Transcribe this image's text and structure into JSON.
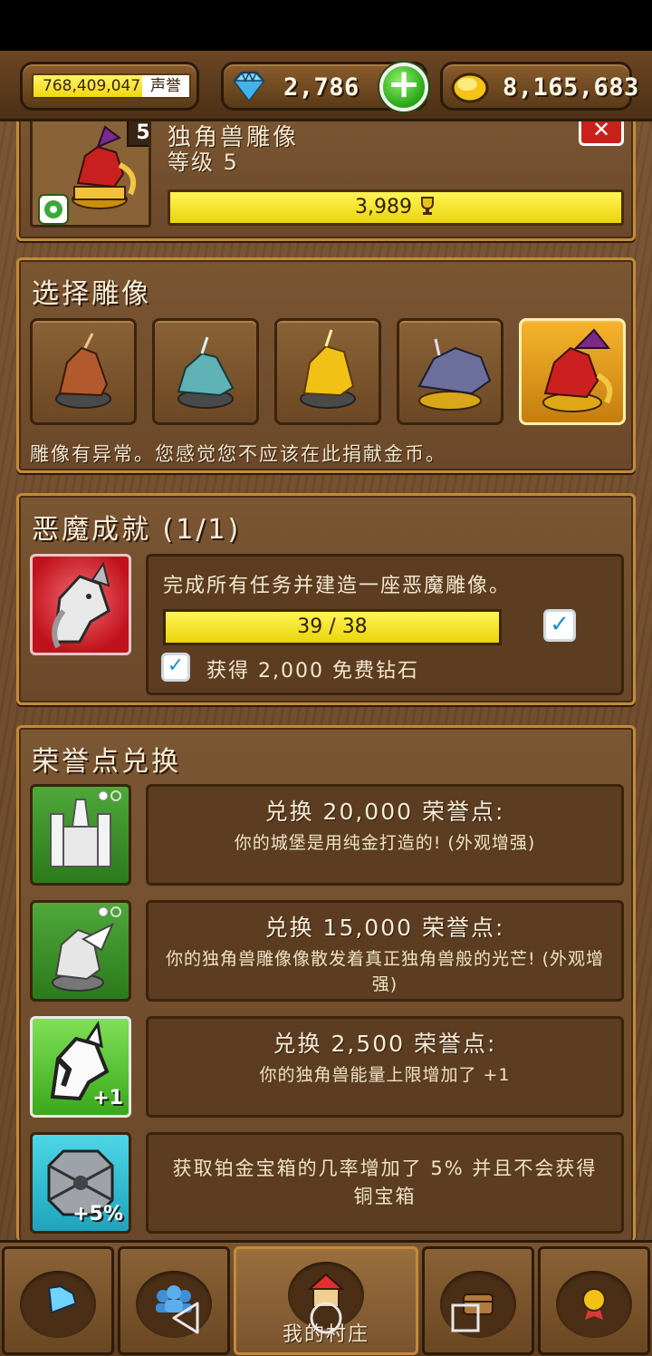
{
  "topbar": {
    "prestige_value": "768,409,047",
    "prestige_suffix": "声誉",
    "gems": "2,786",
    "add_label": "+",
    "gold": "8,165,683"
  },
  "statue_header": {
    "name": "独角兽雕像",
    "level": "等级 5",
    "level_badge": "5",
    "trophies": "3,989",
    "close_label": "✕"
  },
  "select_statue": {
    "title": "选择雕像",
    "statues": [
      "bronze-unicorn-statue",
      "teal-unicorn-statue",
      "gold-unicorn-statue",
      "dark-unicorn-statue",
      "demon-unicorn-statue"
    ],
    "selected_index": 4,
    "description": "雕像有异常。您感觉您不应该在此捐献金币。"
  },
  "demon_achievement": {
    "title": "恶魔成就 (1/1)",
    "description": "完成所有任务并建造一座恶魔雕像。",
    "progress_text": "39 / 38",
    "progress_fraction": 1.0,
    "reward": "获得 2,000 免费钻石"
  },
  "honor_exchange": {
    "title": "荣誉点兑换",
    "rows": [
      {
        "head": "兑换 20,000 荣誉点:",
        "desc": "你的城堡是用纯金打造的! (外观增强)"
      },
      {
        "head": "兑换 15,000 荣誉点:",
        "desc": "你的独角兽雕像像散发着真正独角兽般的光芒! (外观增强)"
      },
      {
        "head": "兑换 2,500 荣誉点:",
        "desc": "你的独角兽能量上限增加了 +1",
        "badge": "+1"
      },
      {
        "desc": "获取铂金宝箱的几率增加了 5% 并且不会获得铜宝箱",
        "badge": "+5%"
      }
    ]
  },
  "bottom_nav": {
    "tabs": [
      "gems",
      "friends",
      "my_village",
      "chest",
      "achievements"
    ],
    "active_label": "我的村庄"
  },
  "colors": {
    "wood": "#6e4b2b",
    "gold_border": "#c48a38",
    "progress_yellow": "#f5e21e",
    "check_blue": "#1f8ed0"
  }
}
